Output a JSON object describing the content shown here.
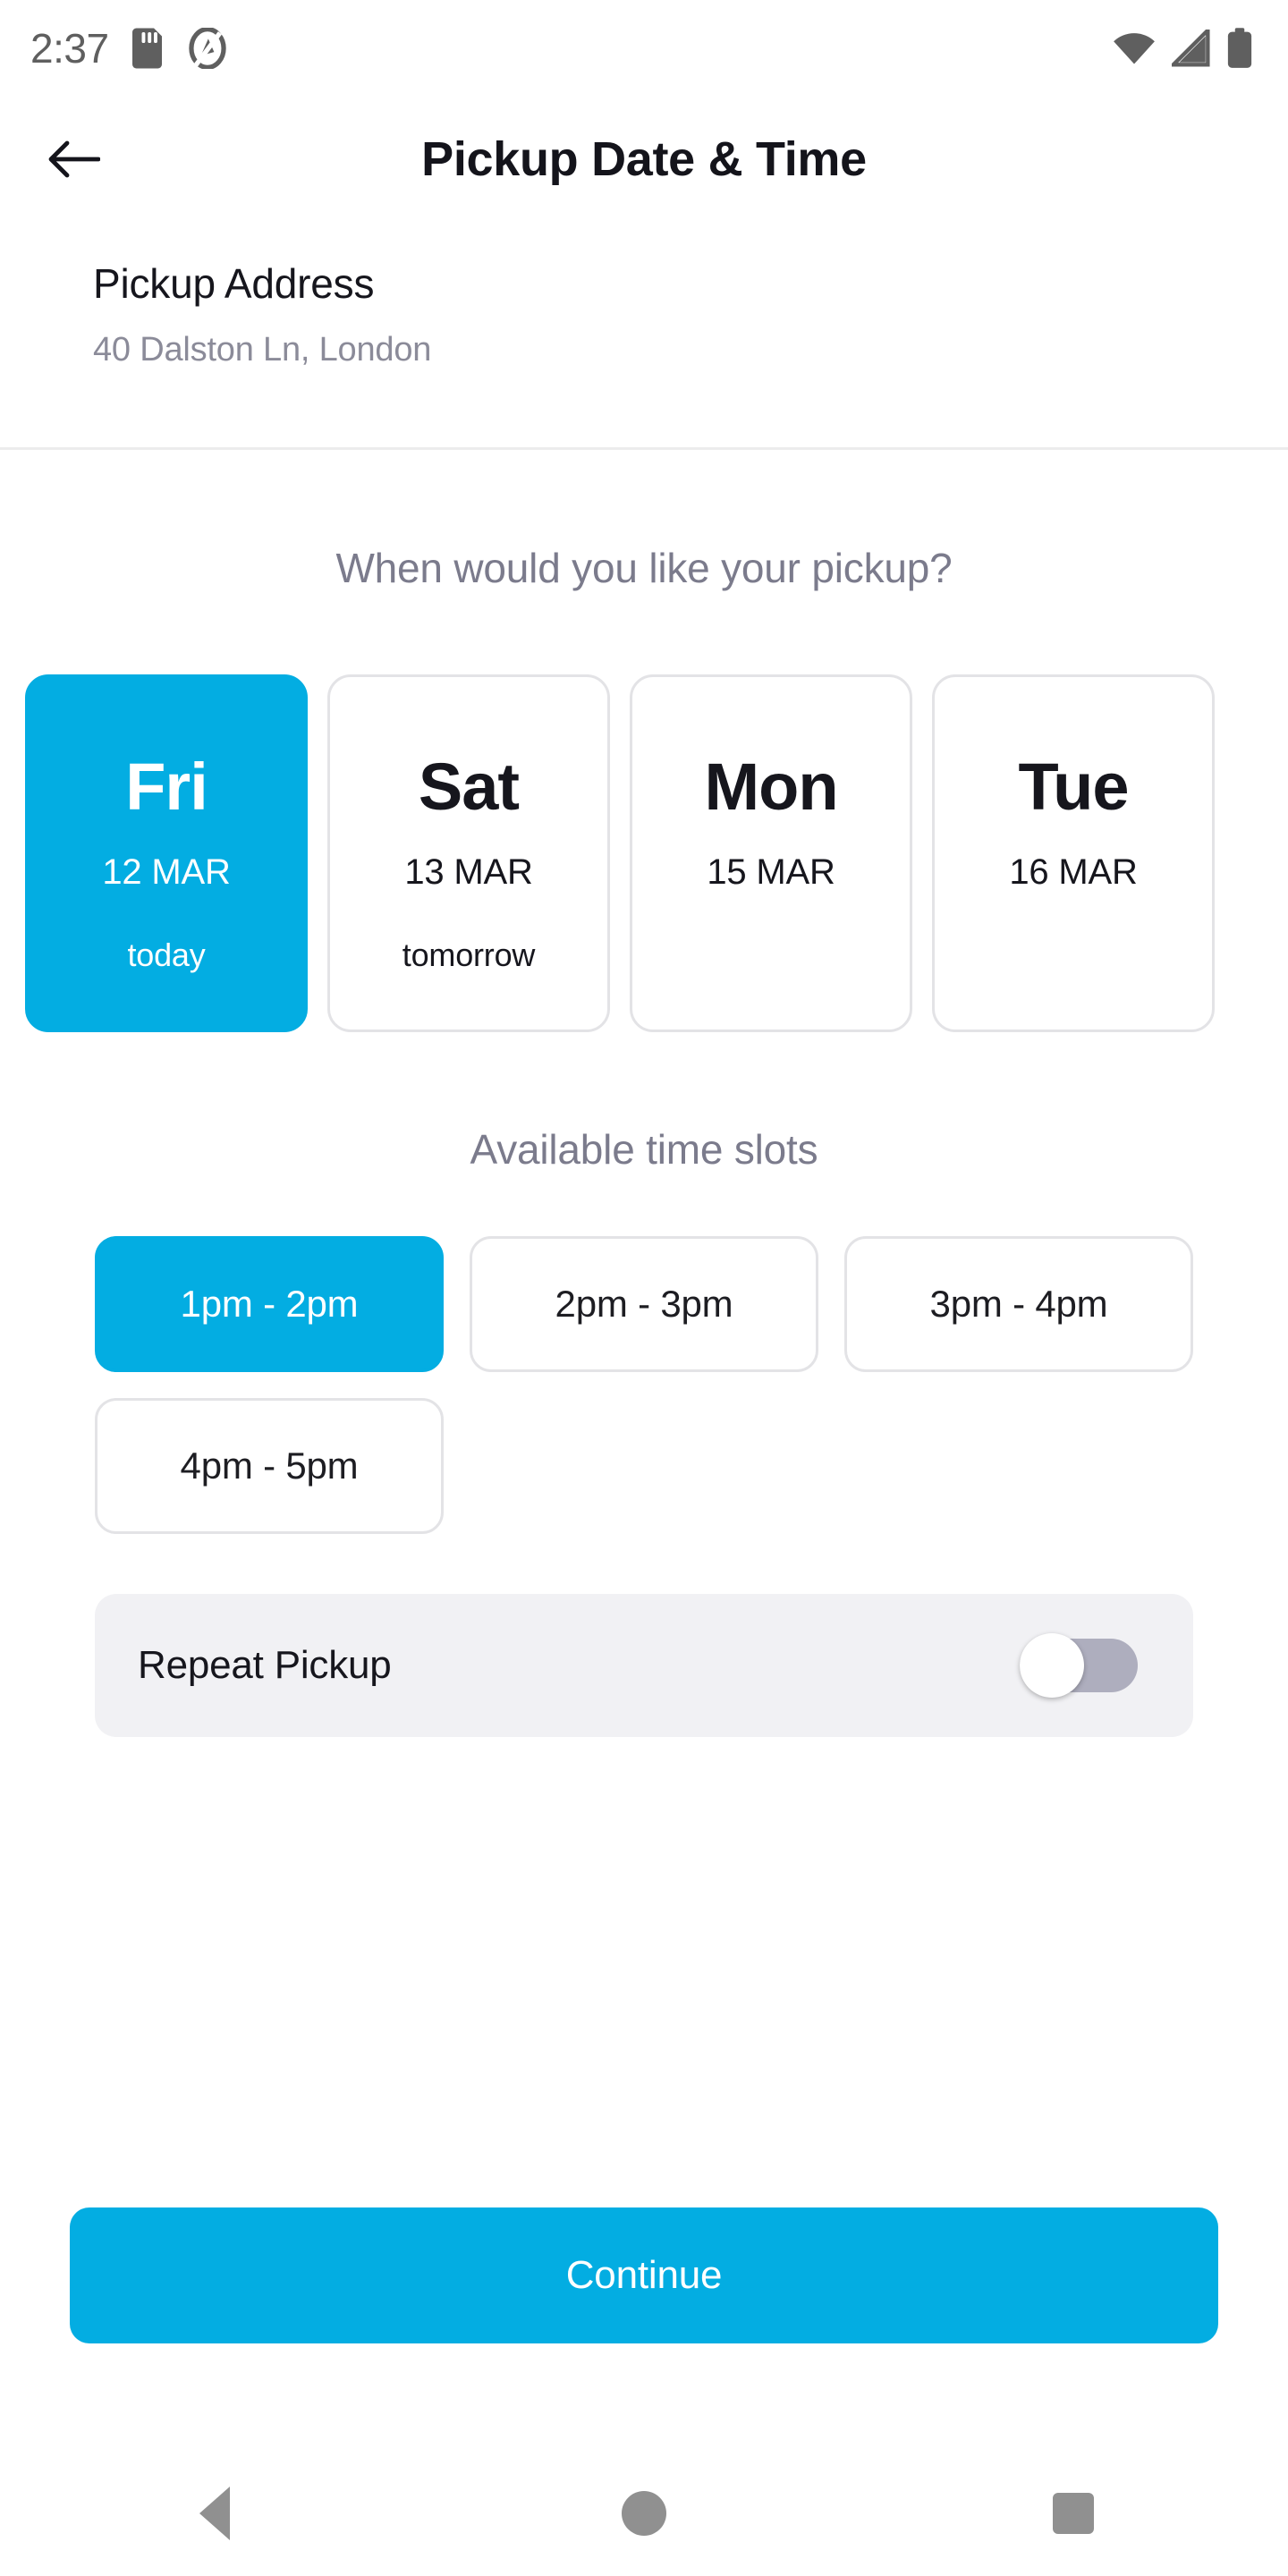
{
  "status_bar": {
    "time": "2:37",
    "icons_left": [
      "sd-card-icon",
      "do-not-disturb-icon"
    ],
    "icons_right": [
      "wifi-icon",
      "cellular-signal-icon",
      "battery-icon"
    ]
  },
  "app_bar": {
    "back_icon": "arrow-left-icon",
    "title": "Pickup Date & Time"
  },
  "address": {
    "title": "Pickup Address",
    "value": "40 Dalston Ln, London"
  },
  "date_section": {
    "heading": "When would you like your pickup?",
    "cards": [
      {
        "day": "Fri",
        "date": "12 MAR",
        "note": "today",
        "selected": true
      },
      {
        "day": "Sat",
        "date": "13 MAR",
        "note": "tomorrow",
        "selected": false
      },
      {
        "day": "Mon",
        "date": "15 MAR",
        "note": "",
        "selected": false
      },
      {
        "day": "Tue",
        "date": "16 MAR",
        "note": "",
        "selected": false
      }
    ]
  },
  "slots_section": {
    "heading": "Available time slots",
    "slots": [
      {
        "label": "1pm - 2pm",
        "selected": true
      },
      {
        "label": "2pm - 3pm",
        "selected": false
      },
      {
        "label": "3pm - 4pm",
        "selected": false
      },
      {
        "label": "4pm - 5pm",
        "selected": false
      }
    ]
  },
  "repeat": {
    "label": "Repeat Pickup",
    "enabled": false
  },
  "footer": {
    "continue_label": "Continue"
  },
  "nav_bar": {
    "back": "nav-back-icon",
    "home": "nav-home-icon",
    "recents": "nav-recents-icon"
  },
  "colors": {
    "accent": "#03ADE2",
    "muted_text": "#7b7b8c",
    "border": "#e3e3e6",
    "repeat_bg": "#f1f1f4",
    "toggle_track": "#aeaebe"
  }
}
